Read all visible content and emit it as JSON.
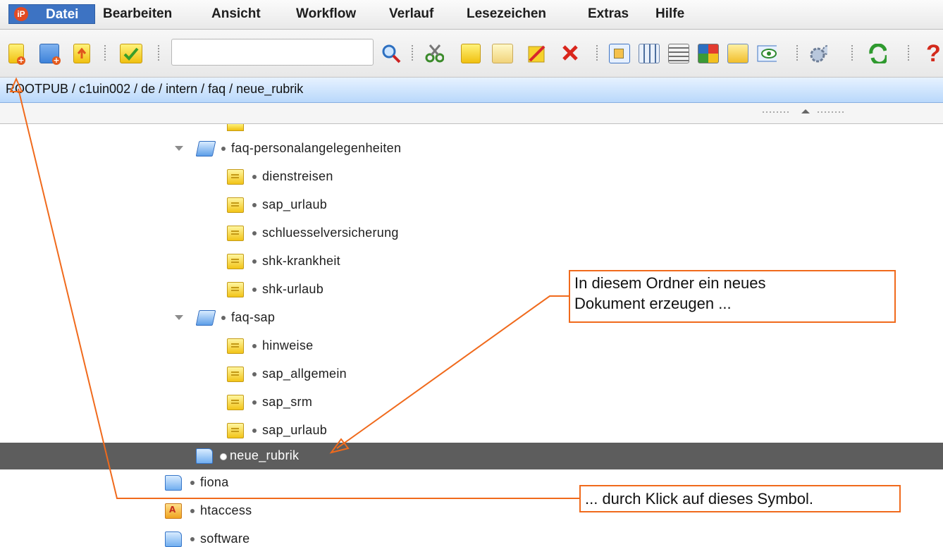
{
  "menubar": {
    "logo_text": "iP",
    "items": [
      "Datei",
      "Bearbeiten",
      "Ansicht",
      "Workflow",
      "Verlauf",
      "Lesezeichen",
      "Extras",
      "Hilfe"
    ]
  },
  "toolbar": {
    "search_value": "",
    "icons": [
      "new-document-icon",
      "new-folder-icon",
      "upload-icon",
      "release-icon",
      "search-icon",
      "cut-icon",
      "copy-icon",
      "paste-icon",
      "edit-icon",
      "delete-icon",
      "view-tree-icon",
      "view-columns-icon",
      "view-list-icon",
      "view-grid-icon",
      "view-details-icon",
      "preview-icon",
      "settings-icon",
      "refresh-icon",
      "help-icon"
    ]
  },
  "breadcrumb": "ROOTPUB / c1uin002 / de / intern / faq / neue_rubrik",
  "tree": {
    "rows": [
      {
        "label": "faq-personalangelegenheiten",
        "type": "folder-open"
      },
      {
        "label": "dienstreisen",
        "type": "doc"
      },
      {
        "label": "sap_urlaub",
        "type": "doc"
      },
      {
        "label": "schluesselversicherung",
        "type": "doc"
      },
      {
        "label": "shk-krankheit",
        "type": "doc"
      },
      {
        "label": "shk-urlaub",
        "type": "doc"
      },
      {
        "label": "faq-sap",
        "type": "folder-open"
      },
      {
        "label": "hinweise",
        "type": "doc"
      },
      {
        "label": "sap_allgemein",
        "type": "doc"
      },
      {
        "label": "sap_srm",
        "type": "doc"
      },
      {
        "label": "sap_urlaub",
        "type": "doc"
      },
      {
        "label": "neue_rubrik",
        "type": "folder",
        "selected": true
      },
      {
        "label": "fiona",
        "type": "folder"
      },
      {
        "label": "htaccess",
        "type": "htaccess"
      },
      {
        "label": "software",
        "type": "folder"
      }
    ]
  },
  "annotations": {
    "top_line1": "In diesem Ordner ein neues",
    "top_line2": "Dokument erzeugen ...",
    "bottom": "... durch Klick auf dieses Symbol."
  },
  "colors": {
    "accent_orange": "#f06a1c",
    "menu_active": "#3d73c3",
    "selected_row": "#5d5d5d"
  }
}
